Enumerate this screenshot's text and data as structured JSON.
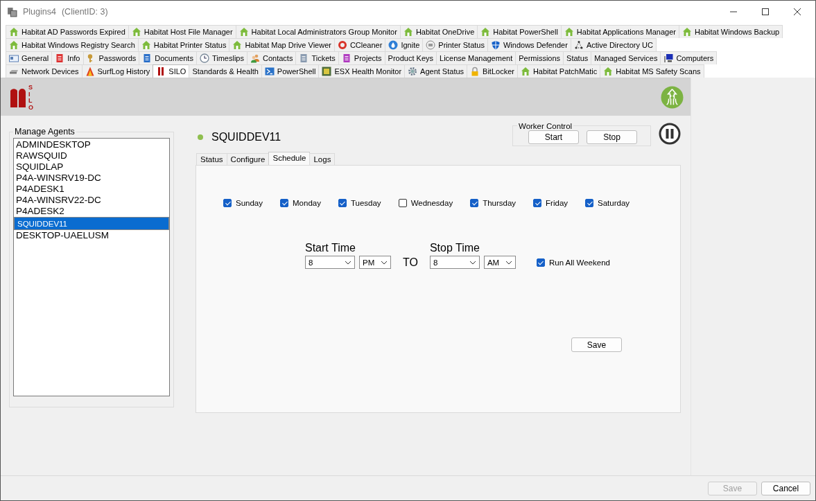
{
  "window": {
    "title": "Plugins4",
    "client": "(ClientID: 3)"
  },
  "tab_rows": [
    [
      {
        "label": "Habitat AD Passwords Expired",
        "kind": "house",
        "selected": false
      },
      {
        "label": "Habitat Host File Manager",
        "kind": "house",
        "selected": false
      },
      {
        "label": "Habitat Local Administrators Group Monitor",
        "kind": "house",
        "selected": false
      },
      {
        "label": "Habitat OneDrive",
        "kind": "house",
        "selected": false
      },
      {
        "label": "Habitat PowerShell",
        "kind": "house",
        "selected": false
      },
      {
        "label": "Habitat Applications Manager",
        "kind": "house",
        "selected": false
      },
      {
        "label": "Habitat Windows Backup",
        "kind": "house",
        "selected": false
      }
    ],
    [
      {
        "label": "Habitat Windows Registry Search",
        "kind": "house",
        "selected": false
      },
      {
        "label": "Habitat Printer Status",
        "kind": "house",
        "selected": false
      },
      {
        "label": "Habitat Map Drive Viewer",
        "kind": "house",
        "selected": false
      },
      {
        "label": "CCleaner",
        "kind": "ring",
        "selected": false
      },
      {
        "label": "Ignite",
        "kind": "drop",
        "selected": false
      },
      {
        "label": "Printer Status",
        "kind": "printer",
        "selected": false
      },
      {
        "label": "Windows Defender",
        "kind": "shield",
        "selected": false
      },
      {
        "label": "Active Directory UC",
        "kind": "tree",
        "selected": false
      }
    ],
    [
      {
        "label": "General",
        "kind": "card",
        "selected": false
      },
      {
        "label": "Info",
        "kind": "doc-red",
        "selected": false
      },
      {
        "label": "Passwords",
        "kind": "keys",
        "selected": false
      },
      {
        "label": "Documents",
        "kind": "doc-blue",
        "selected": false
      },
      {
        "label": "Timeslips",
        "kind": "clock",
        "selected": false
      },
      {
        "label": "Contacts",
        "kind": "people",
        "selected": false
      },
      {
        "label": "Tickets",
        "kind": "doc-gray",
        "selected": false
      },
      {
        "label": "Projects",
        "kind": "doc-purple",
        "selected": false
      },
      {
        "label": "Product Keys",
        "kind": "plain",
        "selected": false
      },
      {
        "label": "License Management",
        "kind": "plain",
        "selected": false
      },
      {
        "label": "Permissions",
        "kind": "plain",
        "selected": false
      },
      {
        "label": "Status",
        "kind": "plain",
        "selected": false
      },
      {
        "label": "Managed Services",
        "kind": "plain",
        "selected": false
      },
      {
        "label": "Computers",
        "kind": "monitor",
        "selected": false
      }
    ],
    [
      {
        "label": "Network Devices",
        "kind": "drive",
        "selected": false
      },
      {
        "label": "SurfLog History",
        "kind": "flame",
        "selected": false
      },
      {
        "label": "SILO",
        "kind": "bars",
        "selected": true
      },
      {
        "label": "Standards & Health",
        "kind": "plain",
        "selected": false
      },
      {
        "label": "PowerShell",
        "kind": "terminal",
        "selected": false
      },
      {
        "label": "ESX Health Monitor",
        "kind": "chip",
        "selected": false
      },
      {
        "label": "Agent Status",
        "kind": "gear",
        "selected": false
      },
      {
        "label": "BitLocker",
        "kind": "lock",
        "selected": false
      },
      {
        "label": "Habitat PatchMatic",
        "kind": "house",
        "selected": false
      },
      {
        "label": "Habitat MS Safety Scans",
        "kind": "house",
        "selected": false
      }
    ]
  ],
  "logo_letters": [
    "S",
    "I",
    "L",
    "O"
  ],
  "agents": {
    "title": "Manage Agents",
    "items": [
      {
        "name": "ADMINDESKTOP",
        "selected": false
      },
      {
        "name": "RAWSQUID",
        "selected": false
      },
      {
        "name": "SQUIDLAP",
        "selected": false
      },
      {
        "name": "P4A-WINSRV19-DC",
        "selected": false
      },
      {
        "name": "P4ADESK1",
        "selected": false
      },
      {
        "name": "P4A-WINSRV22-DC",
        "selected": false
      },
      {
        "name": "P4ADESK2",
        "selected": false
      },
      {
        "name": "SQUIDDEV11",
        "selected": true
      },
      {
        "name": "DESKTOP-UAELUSM",
        "selected": false
      }
    ]
  },
  "agent": {
    "name": "SQUIDDEV11",
    "online": true
  },
  "worker_control": {
    "title": "Worker Control",
    "buttons": [
      "Start",
      "Stop"
    ],
    "paused": true
  },
  "detail_tabs": [
    {
      "label": "Status",
      "selected": false
    },
    {
      "label": "Configure",
      "selected": false
    },
    {
      "label": "Schedule",
      "selected": true
    },
    {
      "label": "Logs",
      "selected": false
    }
  ],
  "days": [
    {
      "label": "Sunday",
      "checked": true
    },
    {
      "label": "Monday",
      "checked": true
    },
    {
      "label": "Tuesday",
      "checked": true
    },
    {
      "label": "Wednesday",
      "checked": false
    },
    {
      "label": "Thursday",
      "checked": true
    },
    {
      "label": "Friday",
      "checked": true
    },
    {
      "label": "Saturday",
      "checked": true
    }
  ],
  "start_time": {
    "label": "Start Time",
    "hour": "8",
    "ampm": "PM"
  },
  "separator": "TO",
  "stop_time": {
    "label": "Stop Time",
    "hour": "8",
    "ampm": "AM"
  },
  "run_all_weekend": {
    "label": "Run All Weekend",
    "checked": true
  },
  "schedule_save": "Save",
  "footer": [
    {
      "label": "Save",
      "disabled": true
    },
    {
      "label": "Cancel",
      "disabled": false
    }
  ]
}
